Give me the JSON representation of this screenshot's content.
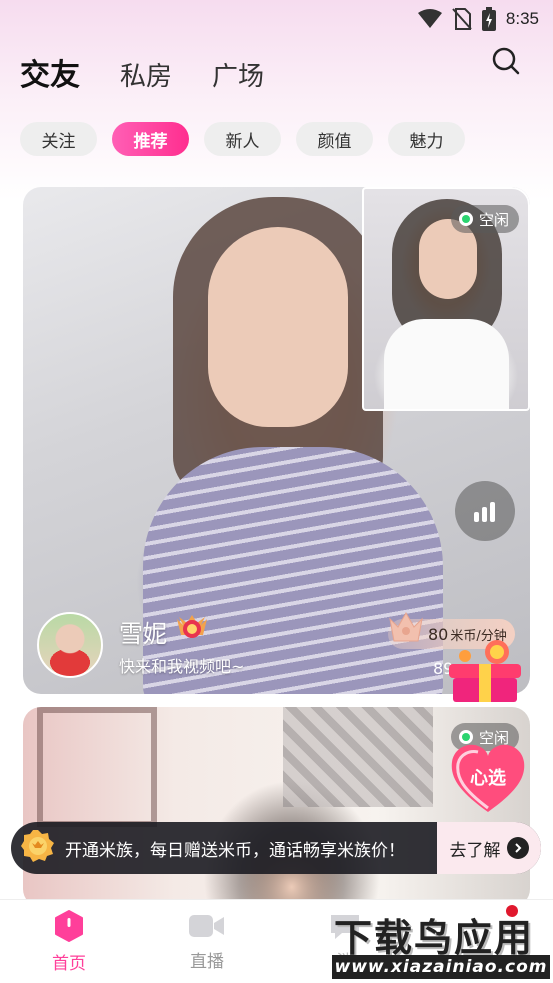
{
  "status_bar": {
    "time": "8:35"
  },
  "header": {
    "tabs": [
      {
        "label": "交友",
        "active": true
      },
      {
        "label": "私房",
        "active": false
      },
      {
        "label": "广场",
        "active": false
      }
    ]
  },
  "filters": [
    {
      "label": "关注",
      "active": false
    },
    {
      "label": "推荐",
      "active": true
    },
    {
      "label": "新人",
      "active": false
    },
    {
      "label": "颜值",
      "active": false
    },
    {
      "label": "魅力",
      "active": false
    }
  ],
  "cards": [
    {
      "status": "空闲",
      "name": "雪妮",
      "subtitle": "快来和我视频吧~",
      "price": "80",
      "price_unit": "米币/分钟",
      "count": "89"
    },
    {
      "status": "空闲"
    }
  ],
  "banner": {
    "text": "开通米族，每日赠送米币，通话畅享米族价！",
    "button": "去了解"
  },
  "bottom_nav": [
    {
      "label": "首页",
      "active": true
    },
    {
      "label": "直播",
      "active": false
    },
    {
      "label": "消",
      "active": false
    }
  ],
  "watermark": {
    "title": "下载鸟应用",
    "url": "www.xiazainiao.com"
  },
  "gift_badge_text": "心选",
  "colors": {
    "accent": "#ff3f9a",
    "chip_active_start": "#ff5fb5",
    "chip_active_end": "#ff2e8f",
    "online_dot": "#2bd46f",
    "banner_bg": "#1c1c22"
  }
}
